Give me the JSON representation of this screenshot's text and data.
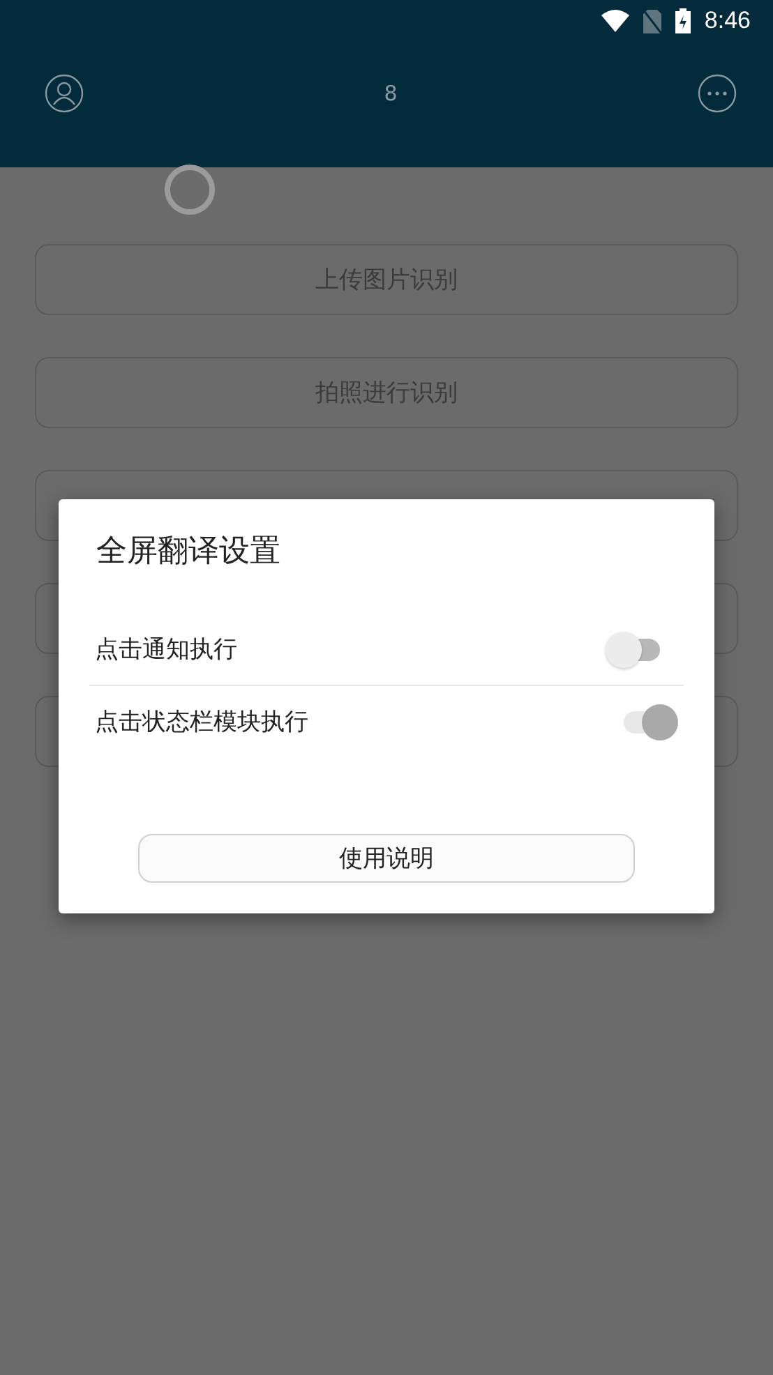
{
  "status_bar": {
    "time": "8:46"
  },
  "header": {
    "title": "8"
  },
  "actions": [
    {
      "kind": "labeled",
      "label": "上传图片识别"
    },
    {
      "kind": "labeled",
      "label": "拍照进行识别"
    },
    {
      "kind": "covered"
    },
    {
      "kind": "covered"
    },
    {
      "kind": "covered"
    }
  ],
  "dialog": {
    "title": "全屏翻译设置",
    "settings": [
      {
        "label": "点击通知执行",
        "on": false
      },
      {
        "label": "点击状态栏模块执行",
        "on": true
      }
    ],
    "button": "使用说明"
  }
}
